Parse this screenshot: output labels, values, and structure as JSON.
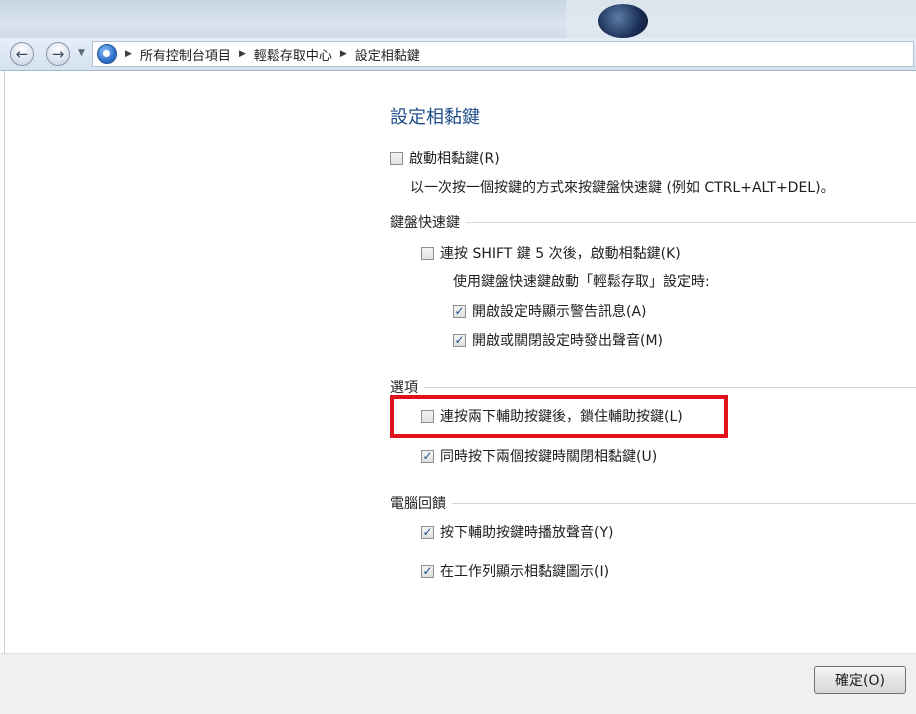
{
  "breadcrumb": {
    "items": [
      "所有控制台項目",
      "輕鬆存取中心",
      "設定相黏鍵"
    ]
  },
  "page": {
    "title": "設定相黏鍵"
  },
  "sticky": {
    "enable_label": "啟動相黏鍵(R)",
    "enable_checked": false,
    "enable_desc": "以一次按一個按鍵的方式來按鍵盤快速鍵 (例如 CTRL+ALT+DEL)。"
  },
  "shortcut": {
    "heading": "鍵盤快速鍵",
    "shift5_label": "連按 SHIFT 鍵 5 次後，啟動相黏鍵(K)",
    "shift5_checked": false,
    "sub_desc": "使用鍵盤快速鍵啟動「輕鬆存取」設定時:",
    "warn_label": "開啟設定時顯示警告訊息(A)",
    "warn_checked": true,
    "sound_label": "開啟或關閉設定時發出聲音(M)",
    "sound_checked": true
  },
  "options": {
    "heading": "選項",
    "lock_label": "連按兩下輔助按鍵後，鎖住輔助按鍵(L)",
    "lock_checked": false,
    "turnoff_label": "同時按下兩個按鍵時關閉相黏鍵(U)",
    "turnoff_checked": true
  },
  "feedback": {
    "heading": "電腦回饋",
    "play_sound_label": "按下輔助按鍵時播放聲音(Y)",
    "play_sound_checked": true,
    "taskbar_label": "在工作列顯示相黏鍵圖示(I)",
    "taskbar_checked": true
  },
  "footer": {
    "ok_label": "確定(O)"
  },
  "icons": {
    "back": "back-arrow-icon",
    "forward": "forward-arrow-icon",
    "control_panel": "control-panel-icon",
    "check": "checkmark-icon"
  },
  "colors": {
    "title": "#1f4e8a",
    "highlight": "#e0101d"
  }
}
